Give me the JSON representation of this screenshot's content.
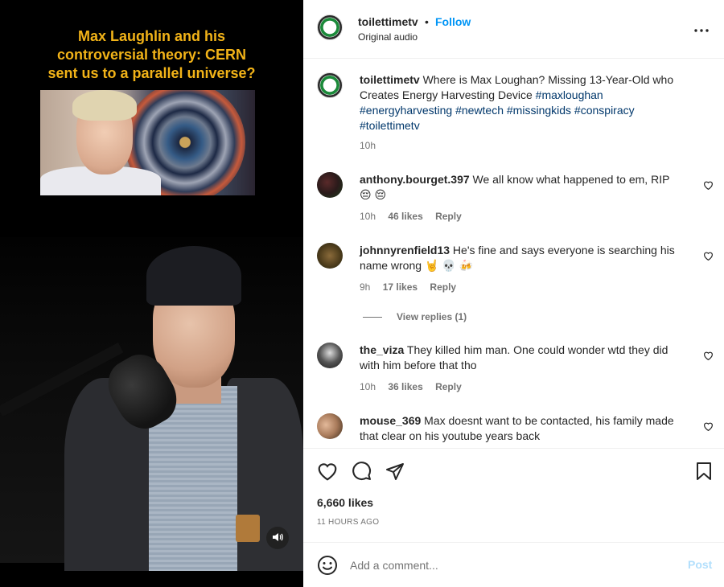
{
  "media": {
    "headline_lines": [
      "Max Laughlin and his",
      "controversial theory: CERN",
      "sent us to a parallel universe?"
    ]
  },
  "header": {
    "username": "toilettimetv",
    "separator": "•",
    "follow_label": "Follow",
    "audio_label": "Original audio"
  },
  "caption": {
    "username": "toilettimetv",
    "text": "Where is Max Loughan? Missing 13-Year-Old who Creates Energy Harvesting Device",
    "hashtags": "#maxloughan #energyharvesting #newtech #missingkids #conspiracy #toilettimetv",
    "time": "10h"
  },
  "comments": [
    {
      "username": "anthony.bourget.397",
      "text": "We all know what happened to em, RIP",
      "emoji": "😔 😔",
      "time": "10h",
      "likes": "46 likes",
      "reply_label": "Reply"
    },
    {
      "username": "johnnyrenfield13",
      "text": "He's fine and says everyone is searching his name wrong",
      "emoji": "🤘 💀 🍻",
      "time": "9h",
      "likes": "17 likes",
      "reply_label": "Reply"
    },
    {
      "username": "the_viza",
      "text": "They killed him man. One could wonder wtd they did with him before that tho",
      "emoji": "",
      "time": "10h",
      "likes": "36 likes",
      "reply_label": "Reply"
    },
    {
      "username": "mouse_369",
      "text": "Max doesnt want to be contacted, his family made that clear on his youtube years back",
      "emoji": "",
      "time": "",
      "likes": "",
      "reply_label": ""
    }
  ],
  "view_replies_label": "View replies (1)",
  "actions": {
    "likes_count": "6,660 likes",
    "posted_ago": "11 HOURS AGO"
  },
  "add_comment": {
    "placeholder": "Add a comment...",
    "post_label": "Post"
  },
  "colors": {
    "link_blue": "#0095f6",
    "hashtag_blue": "#00376b",
    "muted_gray": "#737373",
    "post_disabled": "#b2dffc",
    "headline_gold": "#f2b318"
  },
  "icons": [
    "more-options-icon",
    "heart-icon",
    "comment-icon",
    "share-icon",
    "save-icon",
    "emoji-icon",
    "sound-icon"
  ]
}
